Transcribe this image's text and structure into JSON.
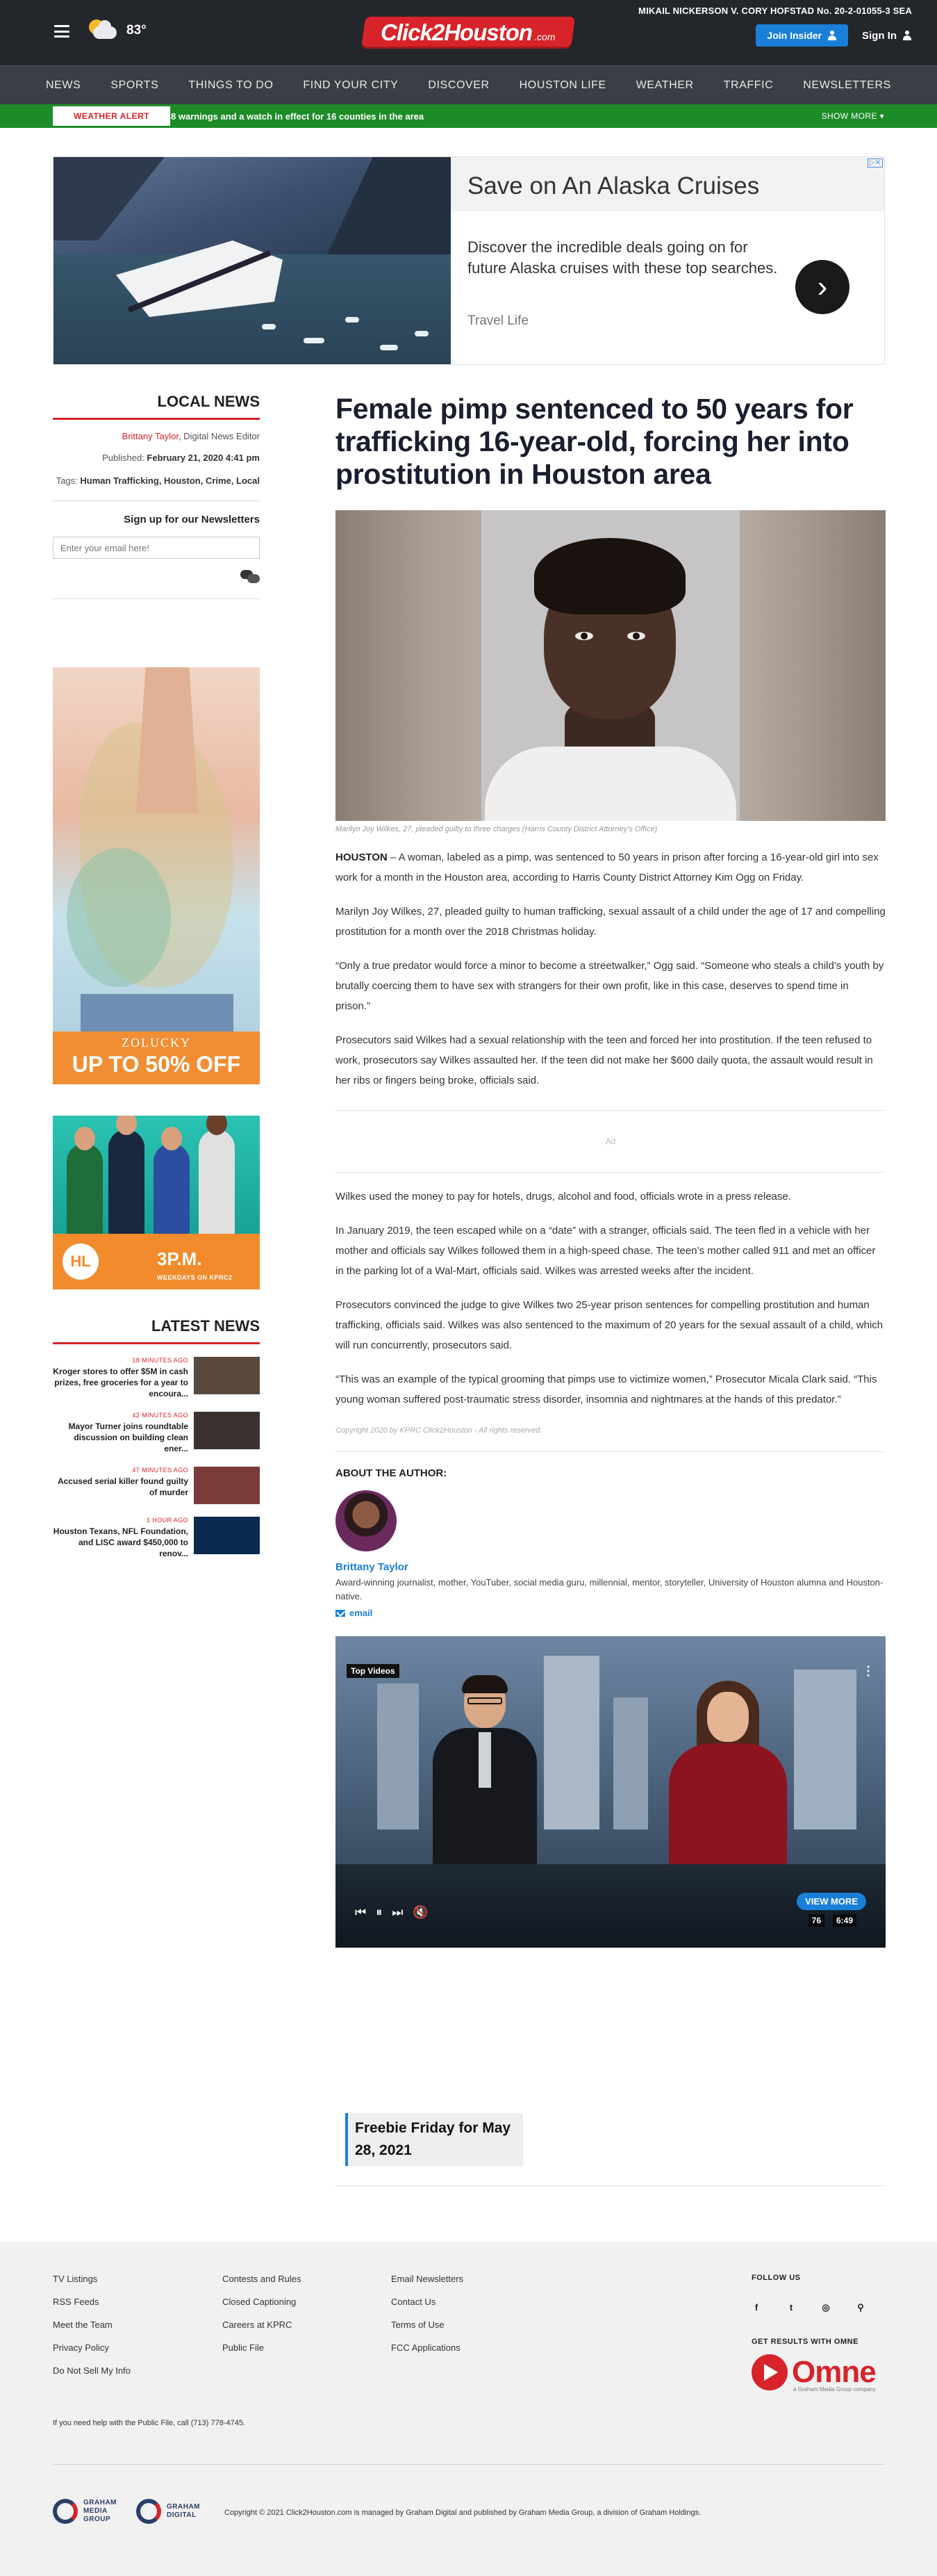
{
  "header": {
    "temperature": "83°",
    "logo_text": "Click2Houston",
    "logo_suffix": ".com",
    "breaking_ticker": "MIKAIL NICKERSON V. CORY HOFSTAD No. 20-2-01055-3 SEA",
    "insider_label": "Join Insider",
    "signin_label": "Sign In"
  },
  "nav": {
    "items": [
      "NEWS",
      "SPORTS",
      "THINGS TO DO",
      "FIND YOUR CITY",
      "DISCOVER",
      "HOUSTON LIFE",
      "WEATHER",
      "TRAFFIC",
      "NEWSLETTERS"
    ]
  },
  "alert": {
    "label": "WEATHER ALERT",
    "text": "8 warnings and a watch in effect for 16 counties in the area",
    "show_more": "SHOW MORE ▾"
  },
  "ad_banner": {
    "title": "Save on An Alaska Cruises",
    "description": "Discover the incredible deals going on for future Alaska cruises with these top searches.",
    "source": "Travel Life",
    "arrow": "›",
    "adchoices": "▷✕"
  },
  "sidebar": {
    "heading": "LOCAL NEWS",
    "author": "Brittany Taylor",
    "author_role": ", Digital News Editor",
    "published_label": "Published: ",
    "published_value": "February 21, 2020 4:41 pm",
    "tags_label": "Tags: ",
    "tags_value": "Human Trafficking, Houston, Crime, Local",
    "signup_label": "Sign up for our Newsletters",
    "email_placeholder": "Enter your email here!",
    "ad1_brand": "ZOLUCKY",
    "ad1_offer": "UP TO 50% OFF",
    "ad2_logo": "HL",
    "ad2_time": "3P.M.",
    "ad2_sub": "WEEKDAYS ON KPRC2",
    "latest_heading": "LATEST NEWS",
    "latest": [
      {
        "time": "18 MINUTES AGO",
        "title": "Kroger stores to offer $5M in cash prizes, free groceries for a year to encoura...",
        "color": "#5a4a3e"
      },
      {
        "time": "42 MINUTES AGO",
        "title": "Mayor Turner joins roundtable discussion on building clean ener...",
        "color": "#3b3230"
      },
      {
        "time": "47 MINUTES AGO",
        "title": "Accused serial killer found guilty of murder",
        "color": "#7a3c3a"
      },
      {
        "time": "1 HOUR AGO",
        "title": "Houston Texans, NFL Foundation, and LISC award $450,000 to renov...",
        "color": "#0b2a4f"
      }
    ]
  },
  "article": {
    "headline": "Female pimp sentenced to 50 years for trafficking 16-year-old, forcing her into prostitution in Houston area",
    "caption": "Marilyn Joy Wilkes, 27, pleaded guilty to three charges (Harris County District Attorney's Office)",
    "dateline": "HOUSTON",
    "p1": " – A woman, labeled as a pimp, was sentenced to 50 years in prison after forcing a 16-year-old girl into sex work for a month in the Houston area, according to Harris County District Attorney Kim Ogg on Friday.",
    "p2": "Marilyn Joy Wilkes, 27, pleaded guilty to human trafficking, sexual assault of a child under the age of 17 and compelling prostitution for a month over the 2018 Christmas holiday.",
    "p3": "“Only a true predator would force a minor to become a streetwalker,” Ogg said. “Someone who steals a child’s youth by brutally coercing them to have sex with strangers for their own profit, like in this case, deserves to spend time in prison.”",
    "p4": "Prosecutors said Wilkes had a sexual relationship with the teen and forced her into prostitution. If the teen refused to work, prosecutors say Wilkes assaulted her. If the teen did not make her $600 daily quota, the assault would result in her ribs or fingers being broke, officials said.",
    "inline_ad": "Ad",
    "p5": "Wilkes used the money to pay for hotels, drugs, alcohol and food, officials wrote in a press release.",
    "p6": "In January 2019, the teen escaped while on a “date” with a stranger, officials said. The teen fled in a vehicle with her mother and officials say Wilkes followed them in a high-speed chase. The teen’s mother called 911 and met an officer in the parking lot of a Wal-Mart, officials said. Wilkes was arrested weeks after the incident.",
    "p7": "Prosecutors convinced the judge to give Wilkes two 25-year prison sentences for compelling prostitution and human trafficking, officials said. Wilkes was also sentenced to the maximum of 20 years for the sexual assault of a child, which will run concurrently, prosecutors said.",
    "p8": "“This was an example of the typical grooming that pimps use to victimize women,” Prosecutor Micala Clark said. “This young woman suffered post-traumatic stress disorder, insomnia and nightmares at the hands of this predator.”",
    "copyright": "Copyright 2020 by KPRC Click2Houston - All rights reserved.",
    "about_title": "ABOUT THE AUTHOR:",
    "author_name": "Brittany Taylor",
    "author_bio": "Award-winning journalist, mother, YouTuber, social media guru, millennial, mentor, storyteller, University of Houston alumna and Houston-native.",
    "author_email": "email"
  },
  "video": {
    "top_label": "Top Videos",
    "menu": "⋮",
    "view_more": "VIEW MORE",
    "duration": "6:49",
    "volume": "76",
    "title": "Freebie Friday for May 28, 2021"
  },
  "footer": {
    "col1": [
      "TV Listings",
      "RSS Feeds",
      "Meet the Team",
      "Privacy Policy",
      "Do Not Sell My Info"
    ],
    "col2": [
      "Contests and Rules",
      "Closed Captioning",
      "Careers at KPRC",
      "Public File"
    ],
    "col3": [
      "Email Newsletters",
      "Contact Us",
      "Terms of Use",
      "FCC Applications"
    ],
    "follow_title": "FOLLOW US",
    "social": [
      "f",
      "t",
      "◎",
      "⚲"
    ],
    "omne_title": "GET RESULTS WITH OMNE",
    "omne_text": "Omne",
    "omne_sub": "a Graham Media Group company",
    "help": "If you need help with the Public File, call (713) 778-4745.",
    "gmg1": "GRAHAM MEDIA GROUP",
    "gmg2": "GRAHAM DIGITAL",
    "copyright": "Copyright © 2021 Click2Houston.com is managed by Graham Digital and published by Graham Media Group, a division of Graham Holdings."
  }
}
